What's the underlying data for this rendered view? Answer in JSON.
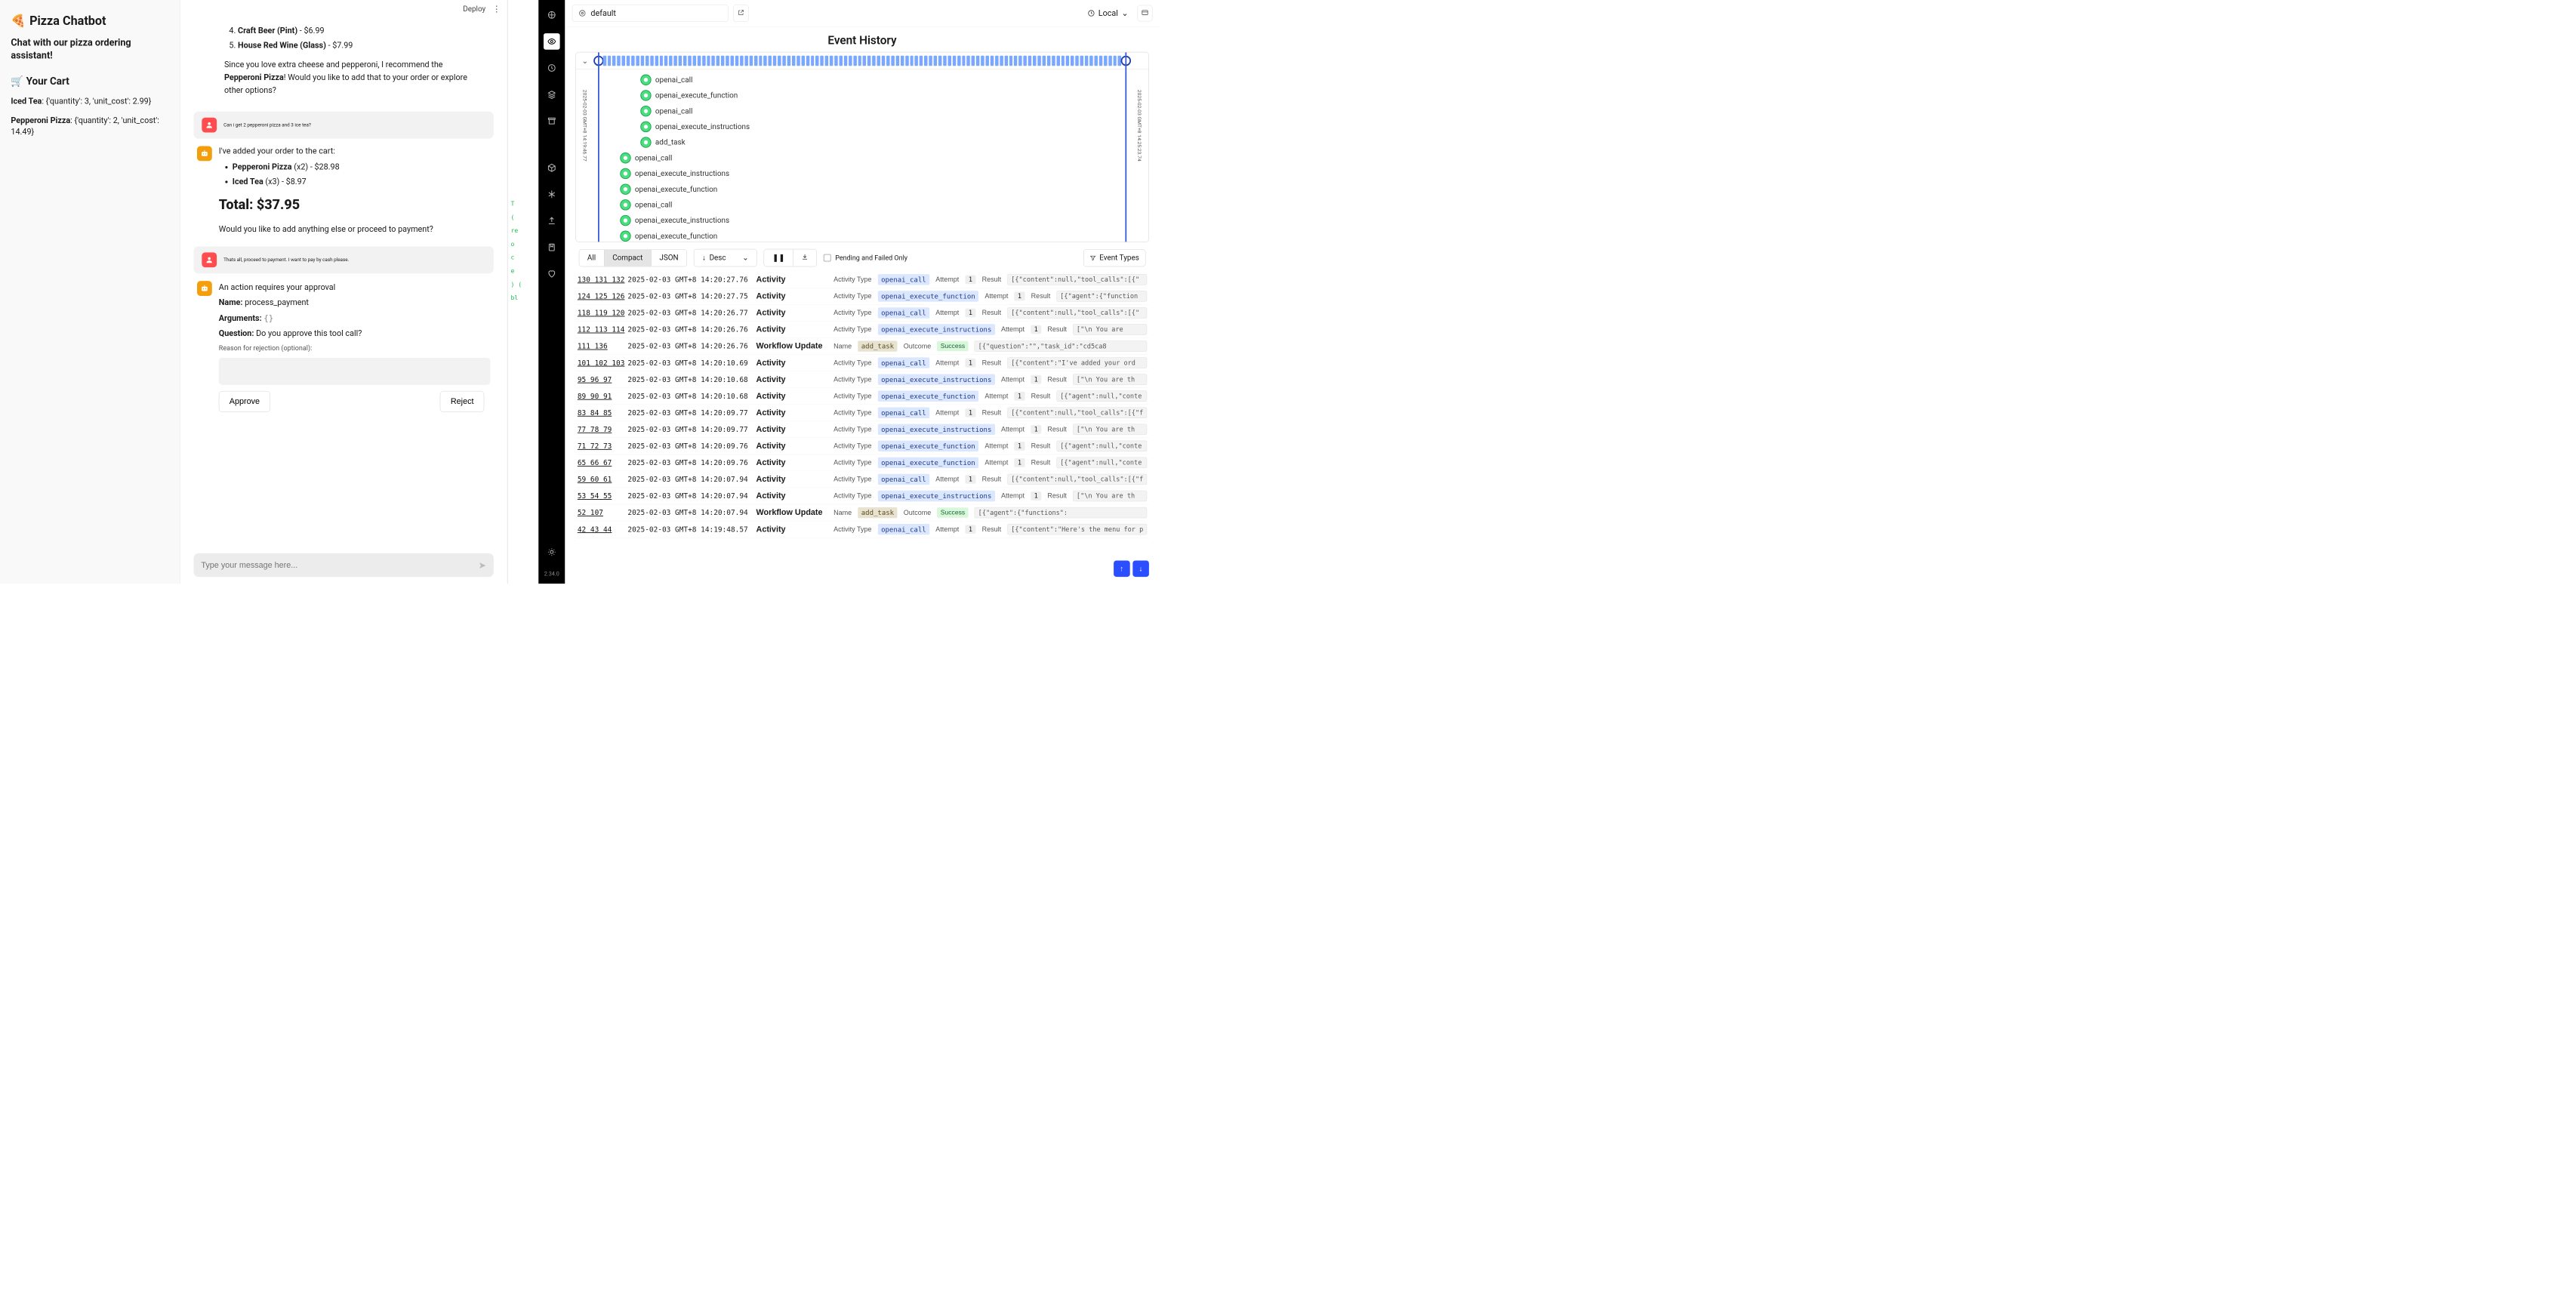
{
  "sidebar": {
    "title": "Pizza Chatbot",
    "emoji": "🍕",
    "subtitle": "Chat with our pizza ordering assistant!",
    "cart_header": "🛒 Your Cart",
    "cart_items": [
      {
        "name": "Iced Tea",
        "detail": ": {'quantity': 3, 'unit_cost': 2.99}"
      },
      {
        "name": "Pepperoni Pizza",
        "detail": ": {'quantity': 2, 'unit_cost': 14.49}"
      }
    ]
  },
  "chat": {
    "deploy": "Deploy",
    "drinks": [
      {
        "n": "4.",
        "name": "Craft Beer (Pint)",
        "price": " - $6.99"
      },
      {
        "n": "5.",
        "name": "House Red Wine (Glass)",
        "price": " - $7.99"
      }
    ],
    "rec_pre": "Since you love extra cheese and pepperoni, I recommend the ",
    "rec_bold": "Pepperoni Pizza",
    "rec_post": "! Would you like to add that to your order or explore other options?",
    "user1": "Can i get 2 pepperoni pizza and 3 ice tea?",
    "bot1": "I've added your order to the cart:",
    "order_lines": [
      {
        "b": "Pepperoni Pizza",
        "rest": " (x2) - $28.98"
      },
      {
        "b": "Iced Tea",
        "rest": " (x3) - $8.97"
      }
    ],
    "total": "Total: $37.95",
    "followup": "Would you like to add anything else or proceed to payment?",
    "user2": "Thats all, proceed to payment. I want to pay by cash please.",
    "approval_title": "An action requires your approval",
    "name_lbl": "Name: ",
    "name_val": "process_payment",
    "args_lbl": "Arguments: ",
    "args_val": "{}",
    "question_lbl": "Question: ",
    "question_val": "Do you approve this tool call?",
    "reject_lbl": "Reason for rejection (optional):",
    "approve": "Approve",
    "reject": "Reject",
    "input_placeholder": "Type your message here..."
  },
  "midnav": {
    "version": "2.34.0"
  },
  "code_peek": [
    "T",
    "(",
    "re",
    "o",
    "c",
    "e",
    ") (",
    "bl"
  ],
  "temporal": {
    "namespace": "default",
    "tz": "Local",
    "title": "Event History",
    "date_left": "2025-02-03 GMT+8 14:19:46.77",
    "date_right": "2025-02-03 GMT+8 14:25:23.74",
    "nodes": [
      {
        "label": "openai_call",
        "indent": 1
      },
      {
        "label": "openai_execute_function",
        "indent": 1
      },
      {
        "label": "openai_call",
        "indent": 1
      },
      {
        "label": "openai_execute_instructions",
        "indent": 1
      },
      {
        "label": "add_task",
        "indent": 1
      },
      {
        "label": "openai_call",
        "indent": 2
      },
      {
        "label": "openai_execute_instructions",
        "indent": 2
      },
      {
        "label": "openai_execute_function",
        "indent": 2
      },
      {
        "label": "openai_call",
        "indent": 2
      },
      {
        "label": "openai_execute_instructions",
        "indent": 2
      },
      {
        "label": "openai_execute_function",
        "indent": 2
      }
    ],
    "controls": {
      "all": "All",
      "compact": "Compact",
      "json": "JSON",
      "desc": "Desc",
      "pending": "Pending and Failed Only",
      "event_types": "Event Types"
    },
    "events": [
      {
        "ids": "130 131 132",
        "ts": "2025-02-03 GMT+8 14:20:27.76",
        "kind": "Activity",
        "label": "Activity Type",
        "tag": "openai_call",
        "att_l": "Attempt",
        "att": "1",
        "res_l": "Result",
        "res": "[{\"content\":null,\"tool_calls\":[{\""
      },
      {
        "ids": "124 125 126",
        "ts": "2025-02-03 GMT+8 14:20:27.75",
        "kind": "Activity",
        "label": "Activity Type",
        "tag": "openai_execute_function",
        "att_l": "Attempt",
        "att": "1",
        "res_l": "Result",
        "res": "[{\"agent\":{\"function"
      },
      {
        "ids": "118 119 120",
        "ts": "2025-02-03 GMT+8 14:20:26.77",
        "kind": "Activity",
        "label": "Activity Type",
        "tag": "openai_call",
        "att_l": "Attempt",
        "att": "1",
        "res_l": "Result",
        "res": "[{\"content\":null,\"tool_calls\":[{\""
      },
      {
        "ids": "112 113 114",
        "ts": "2025-02-03 GMT+8 14:20:26.76",
        "kind": "Activity",
        "label": "Activity Type",
        "tag": "openai_execute_instructions",
        "att_l": "Attempt",
        "att": "1",
        "res_l": "Result",
        "res": "[\"\\n    You are"
      },
      {
        "ids": "111 136",
        "ts": "2025-02-03 GMT+8 14:20:26.76",
        "kind": "Workflow Update",
        "label": "Name",
        "tag": "add_task",
        "task": true,
        "outcome_l": "Outcome",
        "outcome": "Success",
        "res": "[{\"question\":\"\",\"task_id\":\"cd5ca8"
      },
      {
        "ids": "101 102 103",
        "ts": "2025-02-03 GMT+8 14:20:10.69",
        "kind": "Activity",
        "label": "Activity Type",
        "tag": "openai_call",
        "att_l": "Attempt",
        "att": "1",
        "res_l": "Result",
        "res": "[{\"content\":\"I've added your ord"
      },
      {
        "ids": "95 96 97",
        "ts": "2025-02-03 GMT+8 14:20:10.68",
        "kind": "Activity",
        "label": "Activity Type",
        "tag": "openai_execute_instructions",
        "att_l": "Attempt",
        "att": "1",
        "res_l": "Result",
        "res": "[\"\\n    You are th"
      },
      {
        "ids": "89 90 91",
        "ts": "2025-02-03 GMT+8 14:20:10.68",
        "kind": "Activity",
        "label": "Activity Type",
        "tag": "openai_execute_function",
        "att_l": "Attempt",
        "att": "1",
        "res_l": "Result",
        "res": "[{\"agent\":null,\"conte"
      },
      {
        "ids": "83 84 85",
        "ts": "2025-02-03 GMT+8 14:20:09.77",
        "kind": "Activity",
        "label": "Activity Type",
        "tag": "openai_call",
        "att_l": "Attempt",
        "att": "1",
        "res_l": "Result",
        "res": "[{\"content\":null,\"tool_calls\":[{\"f"
      },
      {
        "ids": "77 78 79",
        "ts": "2025-02-03 GMT+8 14:20:09.77",
        "kind": "Activity",
        "label": "Activity Type",
        "tag": "openai_execute_instructions",
        "att_l": "Attempt",
        "att": "1",
        "res_l": "Result",
        "res": "[\"\\n    You are th"
      },
      {
        "ids": "71 72 73",
        "ts": "2025-02-03 GMT+8 14:20:09.76",
        "kind": "Activity",
        "label": "Activity Type",
        "tag": "openai_execute_function",
        "att_l": "Attempt",
        "att": "1",
        "res_l": "Result",
        "res": "[{\"agent\":null,\"conte"
      },
      {
        "ids": "65 66 67",
        "ts": "2025-02-03 GMT+8 14:20:09.76",
        "kind": "Activity",
        "label": "Activity Type",
        "tag": "openai_execute_function",
        "att_l": "Attempt",
        "att": "1",
        "res_l": "Result",
        "res": "[{\"agent\":null,\"conte"
      },
      {
        "ids": "59 60 61",
        "ts": "2025-02-03 GMT+8 14:20:07.94",
        "kind": "Activity",
        "label": "Activity Type",
        "tag": "openai_call",
        "att_l": "Attempt",
        "att": "1",
        "res_l": "Result",
        "res": "[{\"content\":null,\"tool_calls\":[{\"f"
      },
      {
        "ids": "53 54 55",
        "ts": "2025-02-03 GMT+8 14:20:07.94",
        "kind": "Activity",
        "label": "Activity Type",
        "tag": "openai_execute_instructions",
        "att_l": "Attempt",
        "att": "1",
        "res_l": "Result",
        "res": "[\"\\n    You are th"
      },
      {
        "ids": "52 107",
        "ts": "2025-02-03 GMT+8 14:20:07.94",
        "kind": "Workflow Update",
        "label": "Name",
        "tag": "add_task",
        "task": true,
        "outcome_l": "Outcome",
        "outcome": "Success",
        "res": "[{\"agent\":{\"functions\":"
      },
      {
        "ids": "42 43 44",
        "ts": "2025-02-03 GMT+8 14:19:48.57",
        "kind": "Activity",
        "label": "Activity Type",
        "tag": "openai_call",
        "att_l": "Attempt",
        "att": "1",
        "res_l": "Result",
        "res": "[{\"content\":\"Here's the menu for p"
      }
    ]
  }
}
